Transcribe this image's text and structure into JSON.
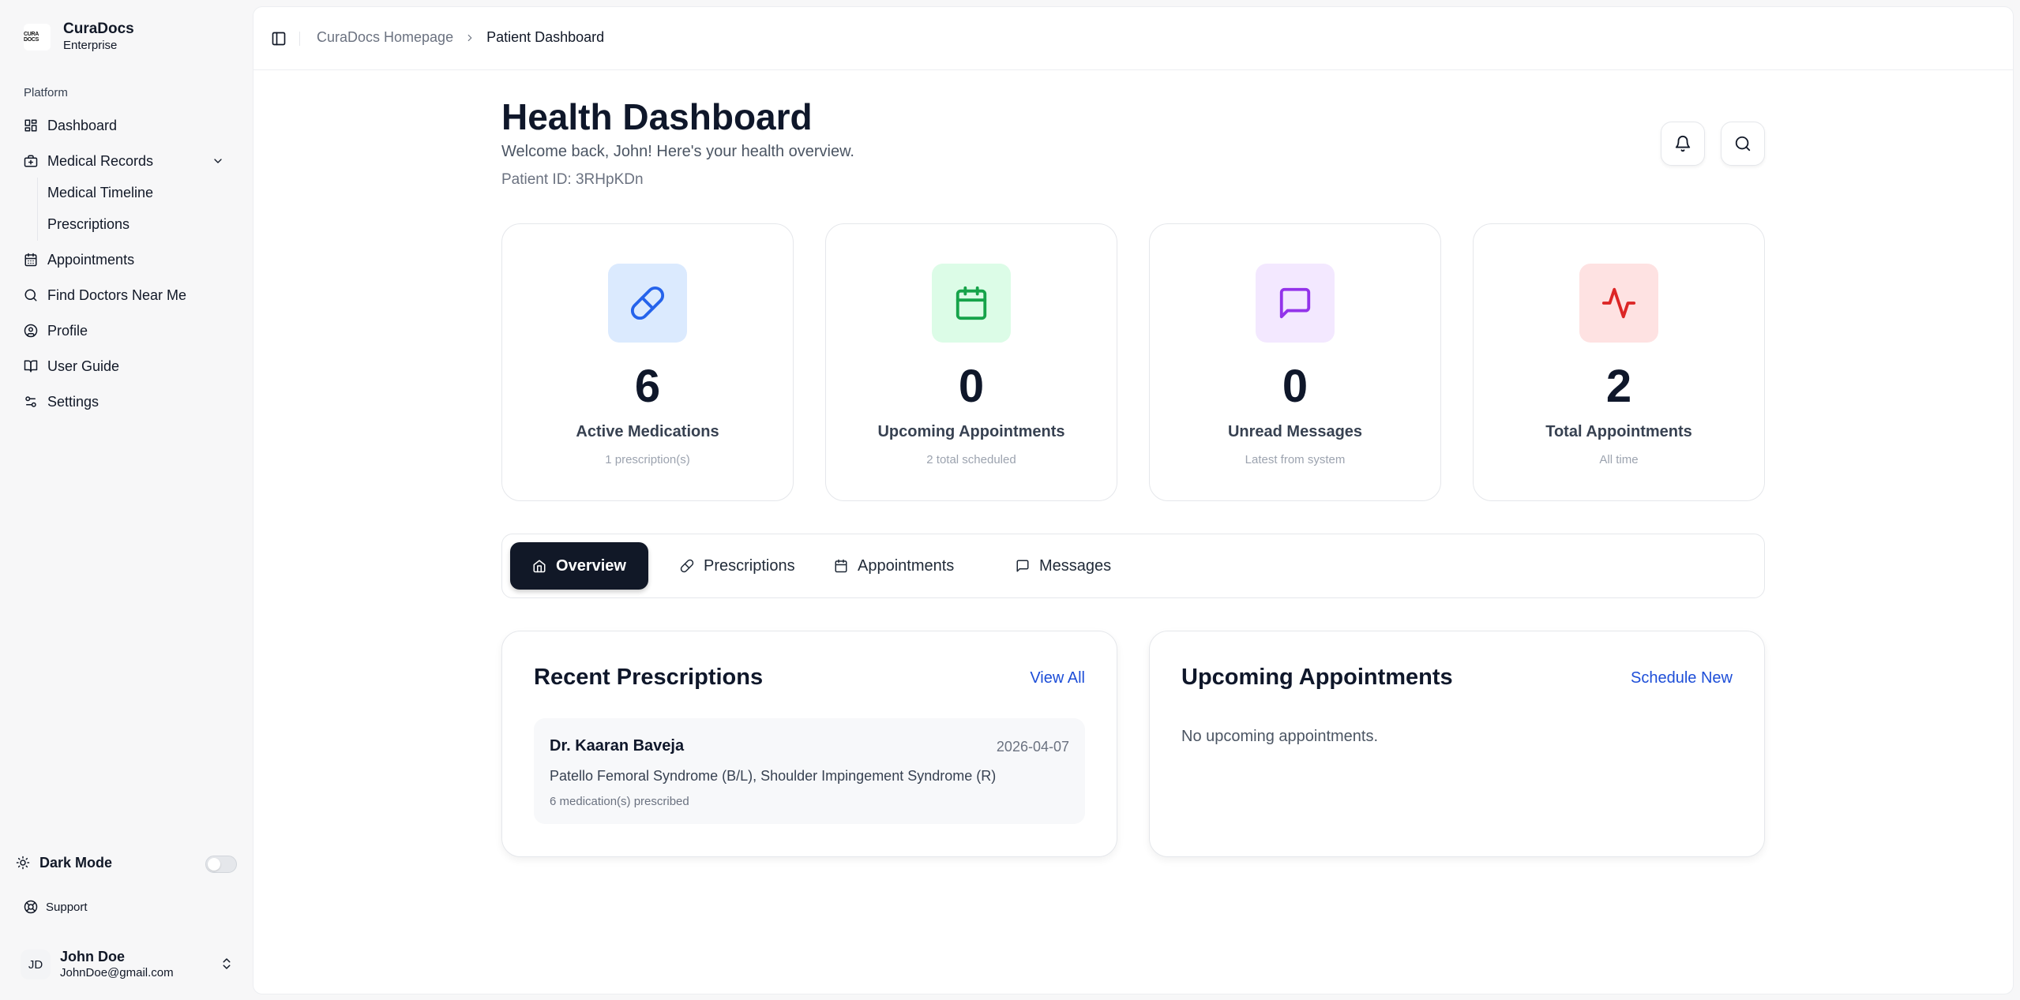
{
  "brand": {
    "logo_text": "CURA DOCS",
    "name": "CuraDocs",
    "subtitle": "Enterprise"
  },
  "sidebar": {
    "group_label": "Platform",
    "items": [
      {
        "label": "Dashboard",
        "icon": "layout-dashboard-icon"
      },
      {
        "label": "Medical Records",
        "icon": "briefcase-medical-icon"
      },
      {
        "label": "Appointments",
        "icon": "calendar-icon"
      },
      {
        "label": "Find Doctors Near Me",
        "icon": "search-icon"
      },
      {
        "label": "Profile",
        "icon": "user-circle-icon"
      },
      {
        "label": "User Guide",
        "icon": "book-open-icon"
      },
      {
        "label": "Settings",
        "icon": "settings-sliders-icon"
      }
    ],
    "sub_items": [
      "Medical Timeline",
      "Prescriptions"
    ],
    "dark_mode_label": "Dark Mode",
    "dark_mode_on": false,
    "support_label": "Support",
    "user": {
      "initials": "JD",
      "name": "John Doe",
      "email": "JohnDoe@gmail.com"
    }
  },
  "breadcrumb": {
    "home": "CuraDocs Homepage",
    "current": "Patient Dashboard"
  },
  "header": {
    "title": "Health Dashboard",
    "welcome": "Welcome back, John! Here's your health overview.",
    "patient_id": "Patient ID: 3RHpKDn"
  },
  "stats": [
    {
      "value": "6",
      "label": "Active Medications",
      "sub": "1 prescription(s)",
      "icon": "pill-icon",
      "color": "#2563eb",
      "bg": "#dbeafe"
    },
    {
      "value": "0",
      "label": "Upcoming Appointments",
      "sub": "2 total scheduled",
      "icon": "calendar-icon",
      "color": "#16a34a",
      "bg": "#dcfce7"
    },
    {
      "value": "0",
      "label": "Unread Messages",
      "sub": "Latest from system",
      "icon": "message-square-icon",
      "color": "#9333ea",
      "bg": "#f3e8ff"
    },
    {
      "value": "2",
      "label": "Total Appointments",
      "sub": "All time",
      "icon": "activity-icon",
      "color": "#dc2626",
      "bg": "#fee2e2"
    }
  ],
  "tabs": [
    {
      "label": "Overview",
      "icon": "home-icon",
      "active": true
    },
    {
      "label": "Prescriptions",
      "icon": "pill-icon",
      "active": false
    },
    {
      "label": "Appointments",
      "icon": "calendar-icon",
      "active": false
    },
    {
      "label": "Messages",
      "icon": "message-square-icon",
      "active": false
    }
  ],
  "recent_prescriptions": {
    "title": "Recent Prescriptions",
    "link": "View All",
    "items": [
      {
        "doctor": "Dr. Kaaran Baveja",
        "date": "2026-04-07",
        "diagnosis": "Patello Femoral Syndrome (B/L), Shoulder Impingement Syndrome (R)",
        "count": "6 medication(s) prescribed"
      }
    ]
  },
  "upcoming_appointments": {
    "title": "Upcoming Appointments",
    "link": "Schedule New",
    "empty": "No upcoming appointments."
  },
  "colors": {
    "accent": "#111827",
    "link": "#1d4ed8"
  }
}
